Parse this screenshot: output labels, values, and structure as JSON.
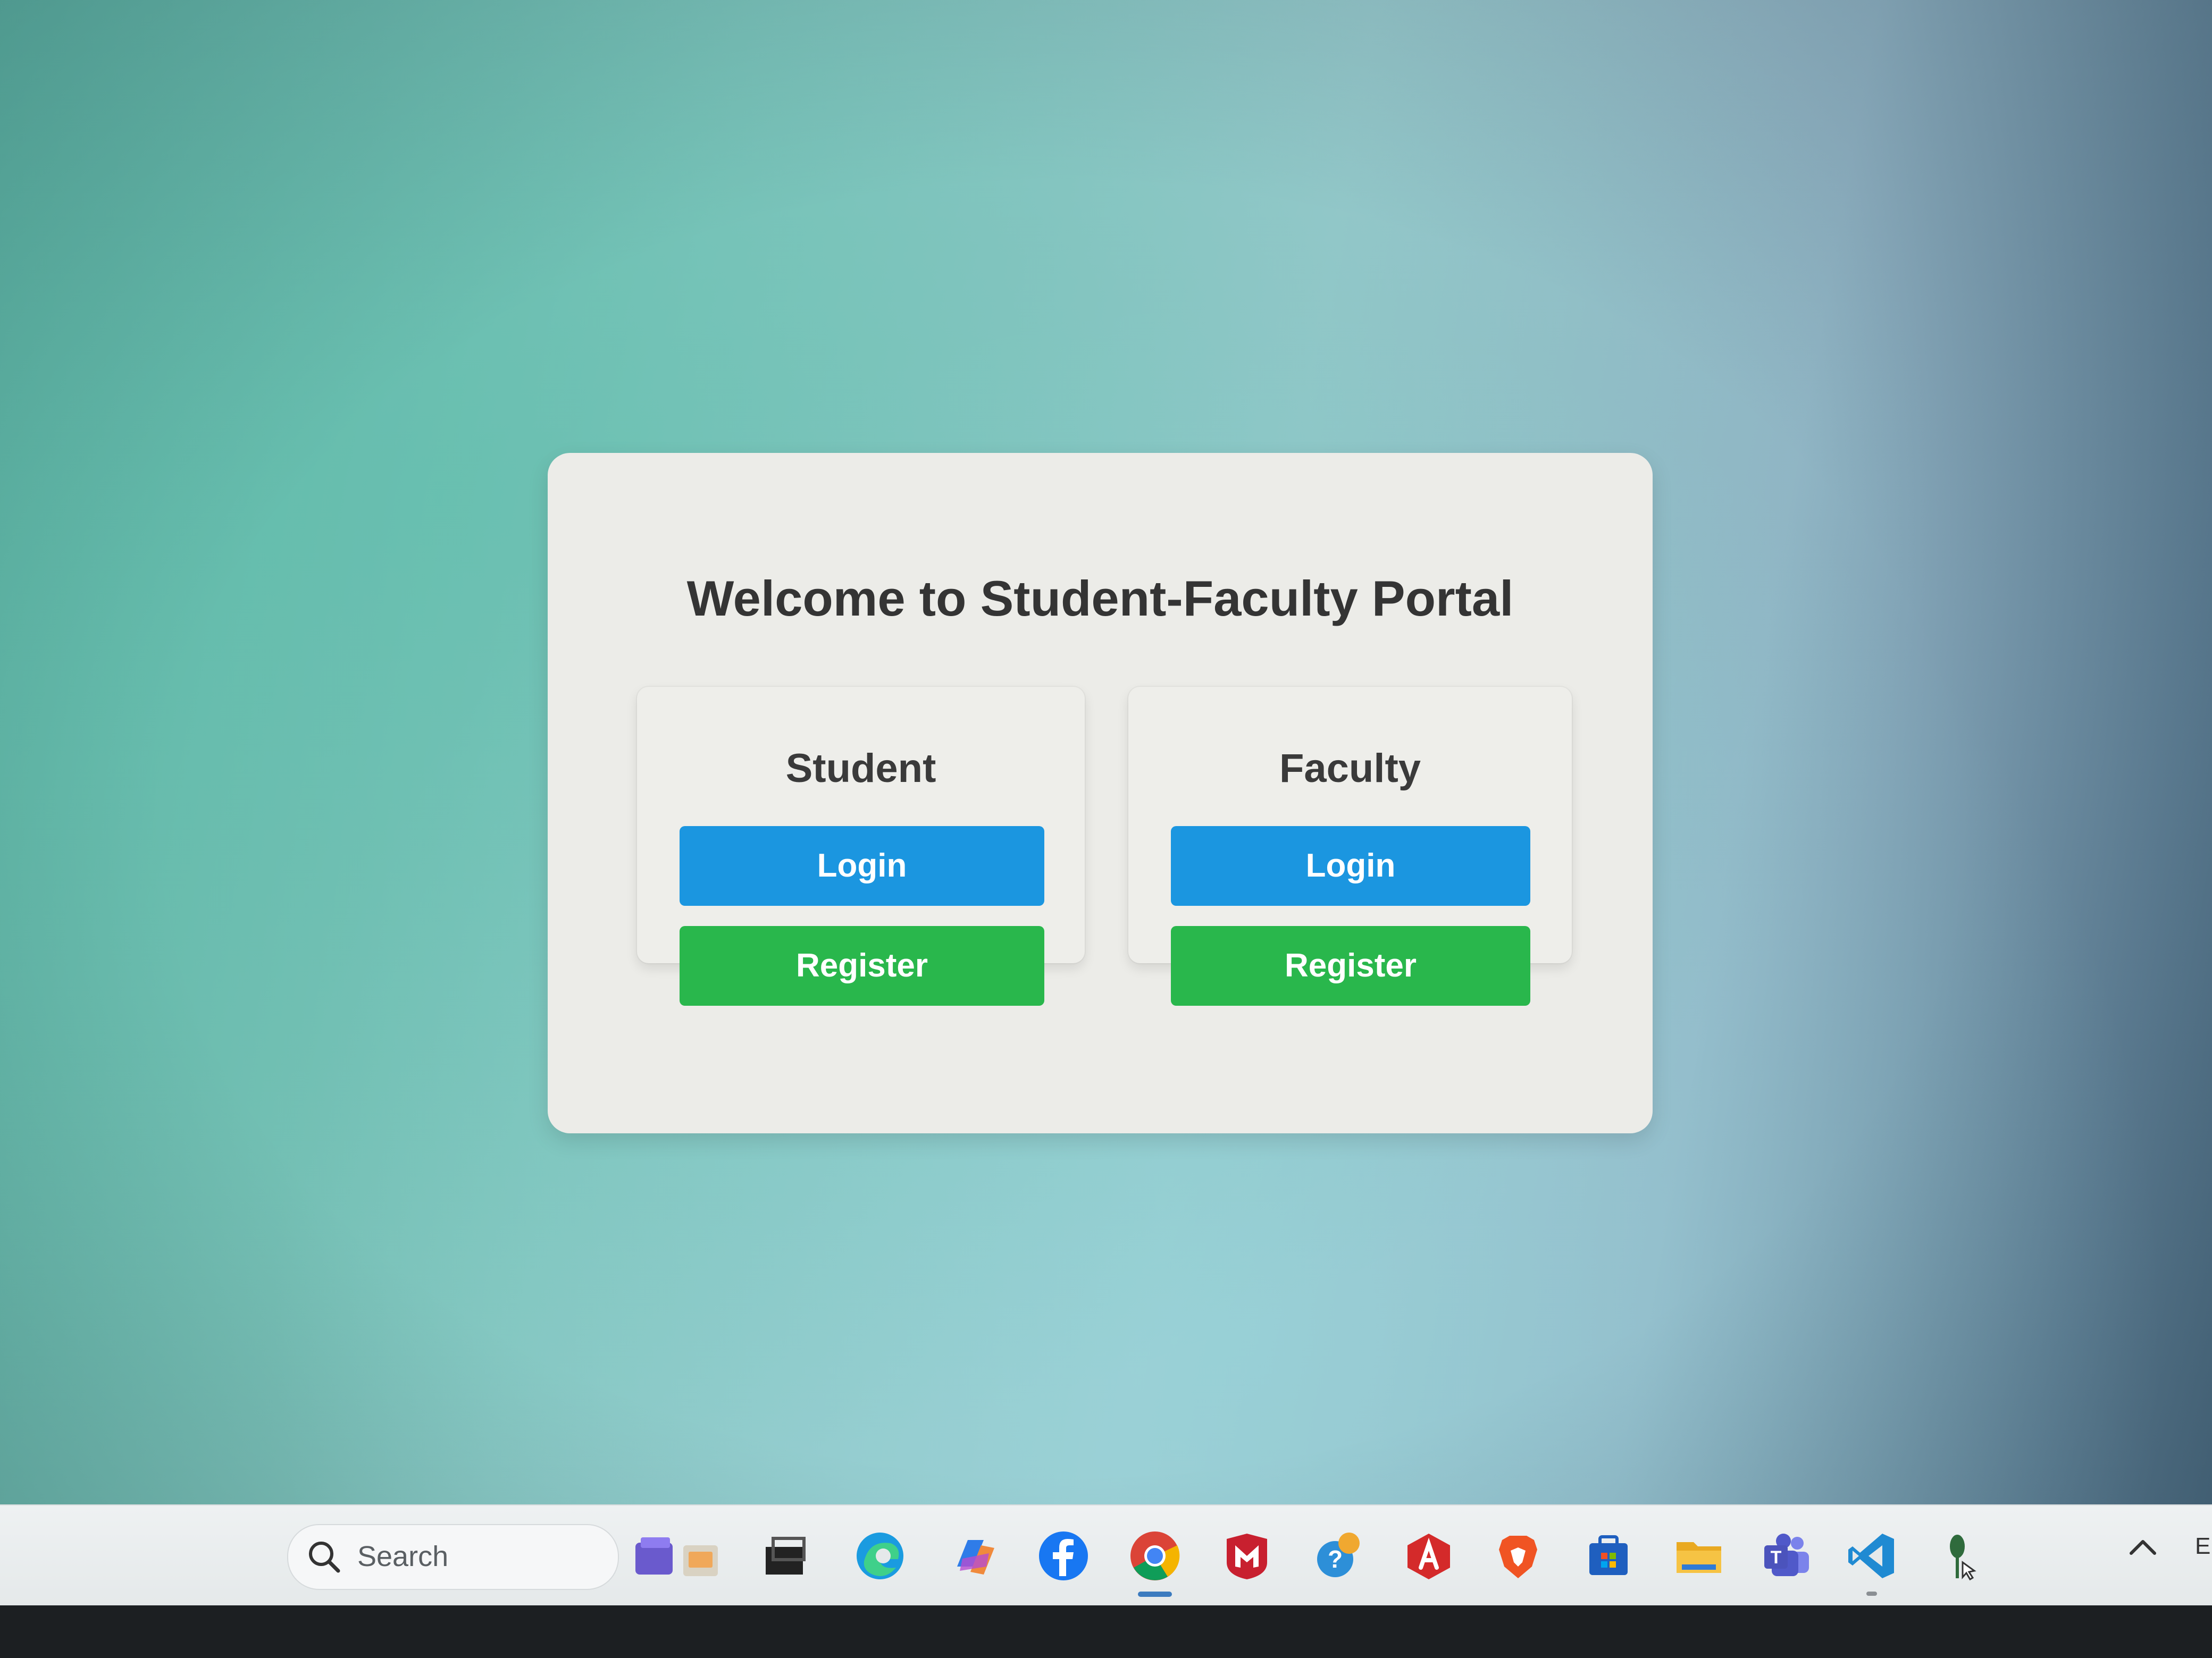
{
  "portal": {
    "title": "Welcome to Student-Faculty Portal",
    "student": {
      "heading": "Student",
      "login_label": "Login",
      "register_label": "Register"
    },
    "faculty": {
      "heading": "Faculty",
      "login_label": "Login",
      "register_label": "Register"
    },
    "colors": {
      "login": "#1b96e0",
      "register": "#29b74c"
    }
  },
  "taskbar": {
    "search_label": "Search",
    "tray_text": "EI",
    "apps": [
      "start-icon",
      "search-icon",
      "widgets-icon",
      "task-view-icon",
      "edge-icon",
      "copilot-icon",
      "facebook-icon",
      "chrome-icon",
      "mcafee-icon",
      "help-icon",
      "acrobat-icon",
      "brave-icon",
      "store-icon",
      "file-explorer-icon",
      "teams-icon",
      "vscode-icon",
      "pin-app-icon",
      "chevron-up-icon"
    ]
  }
}
